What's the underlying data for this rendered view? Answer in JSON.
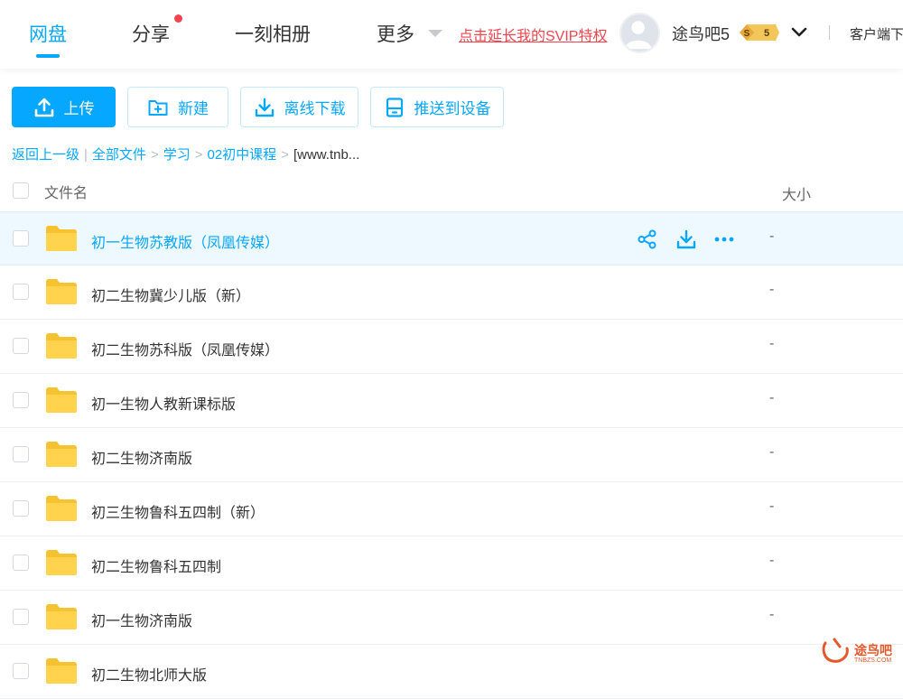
{
  "nav": {
    "tabs": [
      {
        "label": "网盘",
        "active": true
      },
      {
        "label": "分享",
        "badge": "red-dot"
      },
      {
        "label": "一刻相册"
      },
      {
        "label": "更多"
      }
    ],
    "promo_link": "点击延长我的SVIP特权",
    "username": "途鸟吧5",
    "level_badge": "5",
    "client_link": "客户端下"
  },
  "toolbar": {
    "upload": "上传",
    "new": "新建",
    "offline_download": "离线下载",
    "push_to_device": "推送到设备"
  },
  "breadcrumb": {
    "back": "返回上一级",
    "items": [
      "全部文件",
      "学习",
      "02初中课程"
    ],
    "current": "[www.tnb..."
  },
  "table": {
    "col_name": "文件名",
    "col_size": "大小",
    "rows": [
      {
        "name": "初一生物苏教版（凤凰传媒）",
        "size": "-",
        "hover": true
      },
      {
        "name": "初二生物冀少儿版（新）",
        "size": "-"
      },
      {
        "name": "初二生物苏科版（凤凰传媒）",
        "size": "-"
      },
      {
        "name": "初一生物人教新课标版",
        "size": "-"
      },
      {
        "name": "初二生物济南版",
        "size": "-"
      },
      {
        "name": "初三生物鲁科五四制（新）",
        "size": "-"
      },
      {
        "name": "初二生物鲁科五四制",
        "size": "-"
      },
      {
        "name": "初一生物济南版",
        "size": "-"
      },
      {
        "name": "初二生物北师大版",
        "size": ""
      }
    ]
  },
  "watermark": {
    "text": "途鸟吧",
    "sub": "TNBZS.COM"
  },
  "colors": {
    "accent": "#06a7ff",
    "folder": "#ffd34e",
    "alert": "#f0454e"
  }
}
